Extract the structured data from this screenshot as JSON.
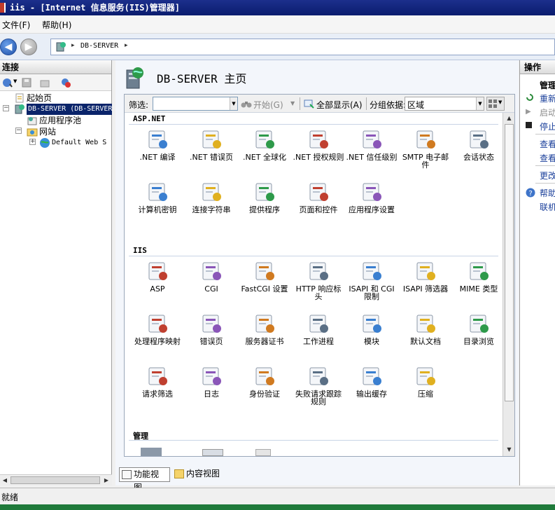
{
  "window": {
    "title": "iis - [Internet 信息服务(IIS)管理器]"
  },
  "menu": {
    "file": "文件(F)",
    "help": "帮助(H)"
  },
  "address": {
    "server": "DB-SERVER",
    "separator": "▸"
  },
  "connections": {
    "header": "连接",
    "tree": {
      "start_page": "起始页",
      "server": "DB-SERVER (DB-SERVER",
      "app_pools": "应用程序池",
      "sites": "网站",
      "default_site": "Default Web S"
    }
  },
  "main": {
    "title": "DB-SERVER 主页",
    "filter": {
      "label": "筛选:",
      "value": "",
      "start": "开始(G)",
      "show_all": "全部显示(A)",
      "group_by_label": "分组依据:",
      "group_by_value": "区域"
    },
    "groups": [
      {
        "name": "ASP.NET",
        "items": [
          ".NET 编译",
          ".NET 错误页",
          ".NET 全球化",
          ".NET 授权规则",
          ".NET 信任级别",
          "SMTP 电子邮件",
          "会话状态",
          "计算机密钥",
          "连接字符串",
          "提供程序",
          "页面和控件",
          "应用程序设置"
        ]
      },
      {
        "name": "IIS",
        "items": [
          "ASP",
          "CGI",
          "FastCGI 设置",
          "HTTP 响应标头",
          "ISAPI 和 CGI 限制",
          "ISAPI 筛选器",
          "MIME 类型",
          "处理程序映射",
          "错误页",
          "服务器证书",
          "工作进程",
          "模块",
          "默认文档",
          "目录浏览",
          "请求筛选",
          "日志",
          "身份验证",
          "失败请求跟踪规则",
          "输出缓存",
          "压缩"
        ]
      },
      {
        "name": "管理",
        "items": []
      }
    ],
    "view_tabs": {
      "features": "功能视图",
      "content": "内容视图"
    }
  },
  "actions": {
    "header": "操作",
    "manage": "管理",
    "restart": "重新",
    "start": "启动",
    "stop": "停止",
    "view1": "查看",
    "view2": "查看",
    "change": "更改",
    "help": "帮助",
    "online": "联机"
  },
  "status": {
    "text": "就绪"
  },
  "colors": {
    "selection": "#0a246a",
    "title_bar": "#1c2f8c",
    "link": "#1a3f9a"
  }
}
